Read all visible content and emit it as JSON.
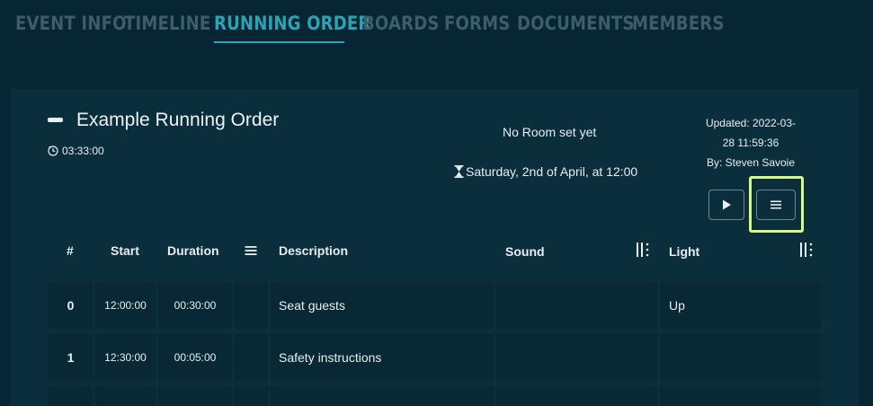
{
  "nav": {
    "tabs": [
      {
        "label": "EVENT INFO",
        "active": false
      },
      {
        "label": "TIMELINE",
        "active": false
      },
      {
        "label": "RUNNING ORDER",
        "active": true
      },
      {
        "label": "BOARDS",
        "active": false
      },
      {
        "label": "FORMS",
        "active": false
      },
      {
        "label": "DOCUMENTS",
        "active": false
      },
      {
        "label": "MEMBERS",
        "active": false
      }
    ]
  },
  "running_order": {
    "title": "Example Running Order",
    "duration": "03:33:00",
    "room": "No Room set yet",
    "date": "Saturday, 2nd of April, at 12:00",
    "updated_line1": "Updated: 2022-03-",
    "updated_line2": "28 11:59:36",
    "updated_by": "By: Steven Savoie"
  },
  "table": {
    "headers": {
      "number": "#",
      "start": "Start",
      "duration": "Duration",
      "description": "Description",
      "sound": "Sound",
      "light": "Light"
    },
    "rows": [
      {
        "number": "0",
        "start": "12:00:00",
        "duration": "00:30:00",
        "description": "Seat guests",
        "sound": "",
        "light": "Up"
      },
      {
        "number": "1",
        "start": "12:30:00",
        "duration": "00:05:00",
        "description": "Safety instructions",
        "sound": "",
        "light": ""
      },
      {
        "number": "",
        "start": "",
        "duration": "",
        "description": "",
        "sound": "",
        "light": ""
      }
    ]
  },
  "colors": {
    "background": "#062634",
    "panel": "#0b2e3d",
    "accent": "#2aa3b5",
    "highlight": "#d6fb8c",
    "nav_inactive": "#3e5c69"
  },
  "icons": [
    "minus-icon",
    "clock-icon",
    "hourglass-icon",
    "play-icon",
    "menu-icon",
    "column-menu-icon",
    "column-resize-icon"
  ]
}
